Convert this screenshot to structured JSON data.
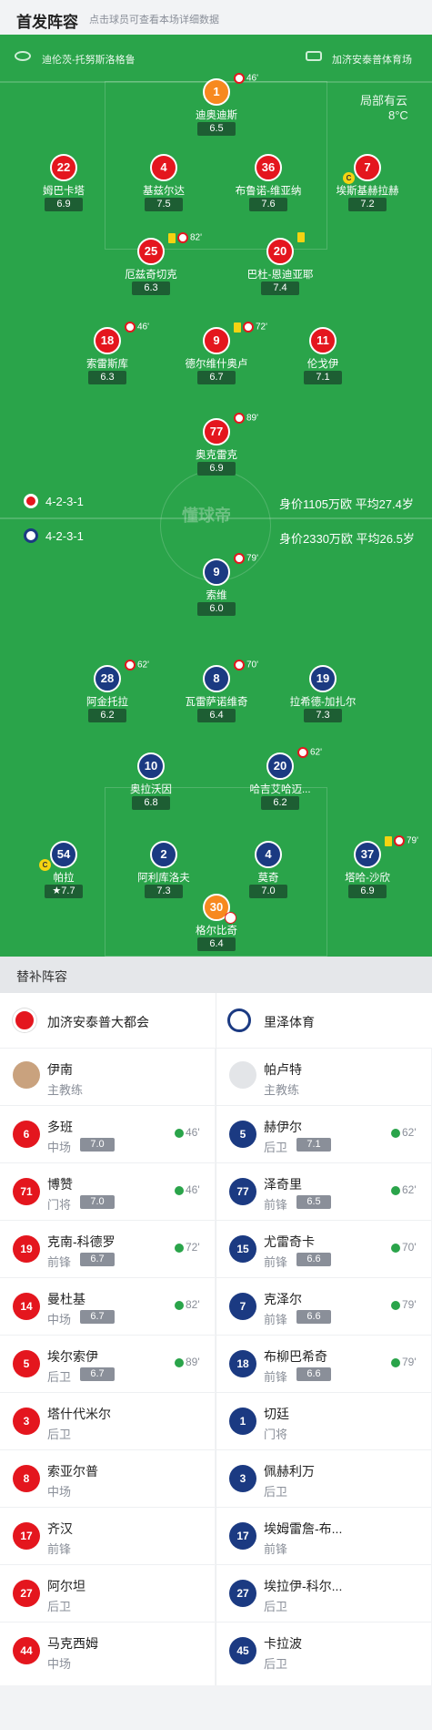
{
  "header": {
    "title": "首发阵容",
    "subtitle": "点击球员可查看本场详细数据"
  },
  "field": {
    "referee": "迪伦茨-托努斯洛格鲁",
    "stadium": "加济安泰普体育场",
    "weather": "局部有云",
    "temp": "8°C",
    "watermark": "懂球帝",
    "home_formation": "4-2-3-1",
    "home_value": "身价1105万欧 平均27.4岁",
    "away_formation": "4-2-3-1",
    "away_value": "身价2330万欧 平均26.5岁"
  },
  "home_players": [
    {
      "num": "1",
      "name": "迪奥迪斯",
      "rating": "6.5",
      "ev": "46'",
      "color": "orange"
    },
    {
      "num": "22",
      "name": "姆巴卡塔",
      "rating": "6.9",
      "color": "red"
    },
    {
      "num": "4",
      "name": "基兹尔达",
      "rating": "7.5",
      "color": "red"
    },
    {
      "num": "36",
      "name": "布鲁诺-维亚纳",
      "rating": "7.6",
      "color": "red"
    },
    {
      "num": "7",
      "name": "埃斯基赫拉赫",
      "rating": "7.2",
      "color": "red"
    },
    {
      "num": "25",
      "name": "厄兹奇切克",
      "rating": "6.3",
      "ev": "82'",
      "color": "red"
    },
    {
      "num": "20",
      "name": "巴杜-恩迪亚耶",
      "rating": "7.4",
      "color": "red"
    },
    {
      "num": "18",
      "name": "索雷斯库",
      "rating": "6.3",
      "ev": "46'",
      "color": "red"
    },
    {
      "num": "9",
      "name": "德尔维什奥卢",
      "rating": "6.7",
      "ev": "72'",
      "color": "red"
    },
    {
      "num": "11",
      "name": "伦戈伊",
      "rating": "7.1",
      "color": "red"
    },
    {
      "num": "77",
      "name": "奥克雷克",
      "rating": "6.9",
      "ev": "89'",
      "color": "red"
    }
  ],
  "away_players": [
    {
      "num": "9",
      "name": "索维",
      "rating": "6.0",
      "ev": "79'",
      "color": "blue"
    },
    {
      "num": "28",
      "name": "阿金托拉",
      "rating": "6.2",
      "ev": "62'",
      "color": "blue"
    },
    {
      "num": "8",
      "name": "瓦雷萨诺维奇",
      "rating": "6.4",
      "ev": "70'",
      "color": "blue"
    },
    {
      "num": "19",
      "name": "拉希德-加扎尔",
      "rating": "7.3",
      "color": "blue"
    },
    {
      "num": "10",
      "name": "奥拉沃因",
      "rating": "6.8",
      "color": "blue"
    },
    {
      "num": "20",
      "name": "哈吉艾哈迈...",
      "rating": "6.2",
      "ev": "62'",
      "color": "blue"
    },
    {
      "num": "54",
      "name": "帕拉",
      "rating": "7.7",
      "color": "blue"
    },
    {
      "num": "2",
      "name": "阿利库洛夫",
      "rating": "7.3",
      "color": "blue"
    },
    {
      "num": "4",
      "name": "莫奇",
      "rating": "7.0",
      "color": "blue"
    },
    {
      "num": "37",
      "name": "塔哈-沙欣",
      "rating": "6.9",
      "ev": "79'",
      "color": "blue"
    },
    {
      "num": "30",
      "name": "格尔比奇",
      "rating": "6.4",
      "color": "orange"
    }
  ],
  "subs": {
    "title": "替补阵容",
    "home_team": "加济安泰普大都会",
    "away_team": "里泽体育",
    "coach_label": "主教练",
    "home_coach": "伊南",
    "away_coach": "帕卢特",
    "home": [
      {
        "num": "6",
        "name": "多班",
        "pos": "中场",
        "rating": "7.0",
        "sub": "46'"
      },
      {
        "num": "71",
        "name": "博赞",
        "pos": "门将",
        "rating": "7.0",
        "sub": "46'"
      },
      {
        "num": "19",
        "name": "克南-科德罗",
        "pos": "前锋",
        "rating": "6.7",
        "sub": "72'"
      },
      {
        "num": "14",
        "name": "曼杜基",
        "pos": "中场",
        "rating": "6.7",
        "sub": "82'"
      },
      {
        "num": "5",
        "name": "埃尔索伊",
        "pos": "后卫",
        "rating": "6.7",
        "sub": "89'"
      },
      {
        "num": "3",
        "name": "塔什代米尔",
        "pos": "后卫"
      },
      {
        "num": "8",
        "name": "索亚尔普",
        "pos": "中场"
      },
      {
        "num": "17",
        "name": "齐汉",
        "pos": "前锋"
      },
      {
        "num": "27",
        "name": "阿尔坦",
        "pos": "后卫"
      },
      {
        "num": "44",
        "name": "马克西姆",
        "pos": "中场"
      }
    ],
    "away": [
      {
        "num": "5",
        "name": "赫伊尔",
        "pos": "后卫",
        "rating": "7.1",
        "sub": "62'"
      },
      {
        "num": "77",
        "name": "泽奇里",
        "pos": "前锋",
        "rating": "6.5",
        "sub": "62'"
      },
      {
        "num": "15",
        "name": "尤雷奇卡",
        "pos": "前锋",
        "rating": "6.6",
        "sub": "70'"
      },
      {
        "num": "7",
        "name": "克泽尔",
        "pos": "前锋",
        "rating": "6.6",
        "sub": "79'"
      },
      {
        "num": "18",
        "name": "布柳巴希奇",
        "pos": "前锋",
        "rating": "6.6",
        "sub": "79'"
      },
      {
        "num": "1",
        "name": "切廷",
        "pos": "门将"
      },
      {
        "num": "3",
        "name": "佩赫利万",
        "pos": "后卫"
      },
      {
        "num": "17",
        "name": "埃姆雷詹-布...",
        "pos": "前锋"
      },
      {
        "num": "27",
        "name": "埃拉伊-科尔...",
        "pos": "后卫"
      },
      {
        "num": "45",
        "name": "卡拉波",
        "pos": "后卫"
      }
    ]
  }
}
